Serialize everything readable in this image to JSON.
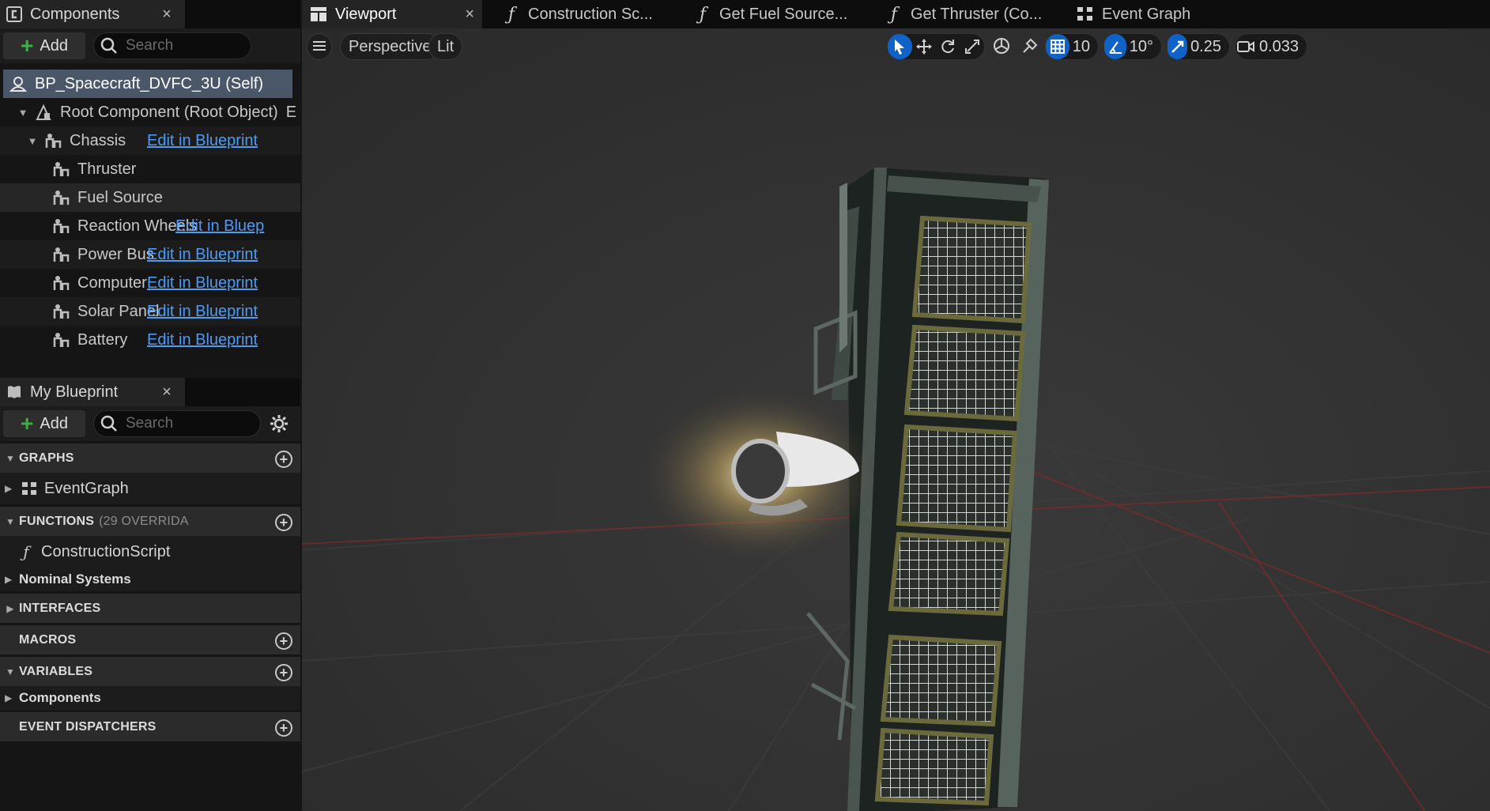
{
  "components_panel": {
    "tab_label": "Components",
    "close_glyph": "×",
    "add_label": "Add",
    "search_placeholder": "Search",
    "self_item": "BP_Spacecraft_DVFC_3U (Self)",
    "root_item": "Root Component (Root Object)",
    "root_trailing": "E",
    "items": [
      {
        "label": "Chassis",
        "link": "Edit in Blueprint"
      },
      {
        "label": "Thruster",
        "link": ""
      },
      {
        "label": "Fuel Source",
        "link": ""
      },
      {
        "label": "Reaction Wheels",
        "link": "Edit in Bluep"
      },
      {
        "label": "Power Bus",
        "link": "Edit in Blueprint"
      },
      {
        "label": "Computer",
        "link": "Edit in Blueprint"
      },
      {
        "label": "Solar Panel",
        "link": "Edit in Blueprint"
      },
      {
        "label": "Battery",
        "link": "Edit in Blueprint"
      }
    ]
  },
  "my_blueprint": {
    "tab_label": "My Blueprint",
    "close_glyph": "×",
    "add_label": "Add",
    "search_placeholder": "Search",
    "graphs": {
      "header": "GRAPHS",
      "item": "EventGraph"
    },
    "functions": {
      "header": "FUNCTIONS",
      "hint": "(29 OVERRIDA",
      "item": "ConstructionScript",
      "category": "Nominal Systems"
    },
    "interfaces": {
      "header": "INTERFACES"
    },
    "macros": {
      "header": "MACROS"
    },
    "variables": {
      "header": "VARIABLES",
      "category": "Components"
    },
    "event_dispatchers": {
      "header": "EVENT DISPATCHERS"
    }
  },
  "document_tabs": [
    {
      "label": "Viewport",
      "icon": "viewport-icon"
    },
    {
      "label": "Construction Sc...",
      "icon": "function-icon"
    },
    {
      "label": "Get Fuel Source...",
      "icon": "function-icon"
    },
    {
      "label": "Get Thruster (Co...",
      "icon": "function-icon"
    },
    {
      "label": "Event Graph",
      "icon": "event-graph-icon"
    }
  ],
  "viewport_toolbar": {
    "perspective_label": "Perspective",
    "lit_label": "Lit",
    "grid_snap": "10",
    "rotation_snap": "10°",
    "scale_snap": "0.25",
    "camera_speed": "0.033"
  },
  "colors": {
    "accent_blue": "#0f63c8",
    "link_blue": "#4b9bf7",
    "selection": "#4a5768",
    "add_green": "#3bb141"
  }
}
